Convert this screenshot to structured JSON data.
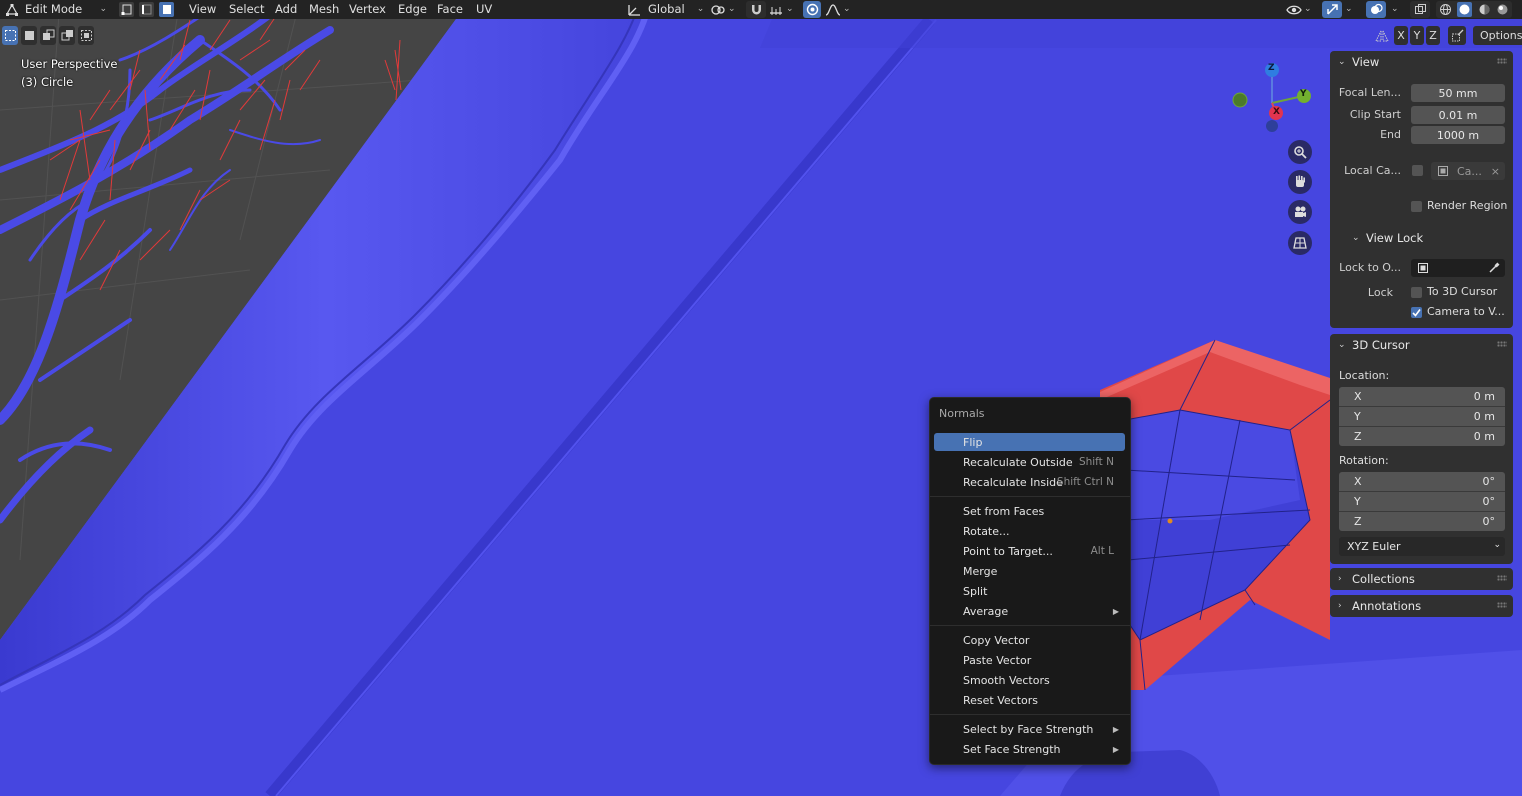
{
  "header": {
    "mode": "Edit Mode",
    "menus": [
      "View",
      "Select",
      "Add",
      "Mesh",
      "Vertex",
      "Edge",
      "Face",
      "UV"
    ],
    "transform_orientation": "Global"
  },
  "toolrow": {
    "axes": [
      "X",
      "Y",
      "Z"
    ],
    "options_label": "Options"
  },
  "viewport": {
    "view_name": "User Perspective",
    "object_name": "(3) Circle"
  },
  "gizmo": {
    "z": "Z",
    "y": "Y",
    "x": "X"
  },
  "sidebar": {
    "view": {
      "title": "View",
      "focal_length_label": "Focal Len...",
      "focal_length_value": "50 mm",
      "clip_start_label": "Clip Start",
      "clip_start_value": "0.01 m",
      "clip_end_label": "End",
      "clip_end_value": "1000 m",
      "local_camera_label": "Local Ca...",
      "local_camera_value": "Ca...",
      "render_region_label": "Render Region"
    },
    "view_lock": {
      "title": "View Lock",
      "lock_to_object_label": "Lock to O...",
      "lock_label": "Lock",
      "to_3d_cursor_label": "To 3D Cursor",
      "camera_to_view_label": "Camera to V..."
    },
    "cursor": {
      "title": "3D Cursor",
      "location_label": "Location:",
      "location": [
        {
          "axis": "X",
          "value": "0 m"
        },
        {
          "axis": "Y",
          "value": "0 m"
        },
        {
          "axis": "Z",
          "value": "0 m"
        }
      ],
      "rotation_label": "Rotation:",
      "rotation": [
        {
          "axis": "X",
          "value": "0°"
        },
        {
          "axis": "Y",
          "value": "0°"
        },
        {
          "axis": "Z",
          "value": "0°"
        }
      ],
      "rotation_mode": "XYZ Euler"
    },
    "collections_title": "Collections",
    "annotations_title": "Annotations"
  },
  "menu": {
    "title": "Normals",
    "items": [
      {
        "label": "Flip",
        "shortcut": ""
      },
      {
        "label": "Recalculate Outside",
        "shortcut": "Shift N"
      },
      {
        "label": "Recalculate Inside",
        "shortcut": "Shift Ctrl N"
      },
      {
        "label": "Set from Faces",
        "shortcut": ""
      },
      {
        "label": "Rotate...",
        "shortcut": ""
      },
      {
        "label": "Point to Target...",
        "shortcut": "Alt L"
      },
      {
        "label": "Merge",
        "shortcut": ""
      },
      {
        "label": "Split",
        "shortcut": ""
      },
      {
        "label": "Average",
        "shortcut": ""
      },
      {
        "label": "Copy Vector",
        "shortcut": ""
      },
      {
        "label": "Paste Vector",
        "shortcut": ""
      },
      {
        "label": "Smooth Vectors",
        "shortcut": ""
      },
      {
        "label": "Reset Vectors",
        "shortcut": ""
      },
      {
        "label": "Select by Face Strength",
        "shortcut": ""
      },
      {
        "label": "Set Face Strength",
        "shortcut": ""
      }
    ]
  },
  "colors": {
    "accent": "#4772b3",
    "mesh_blue": "#4646e0",
    "selected_faces": "#e04848",
    "header_bg": "#232323",
    "panel_bg": "#303030",
    "menu_bg": "#191919"
  }
}
